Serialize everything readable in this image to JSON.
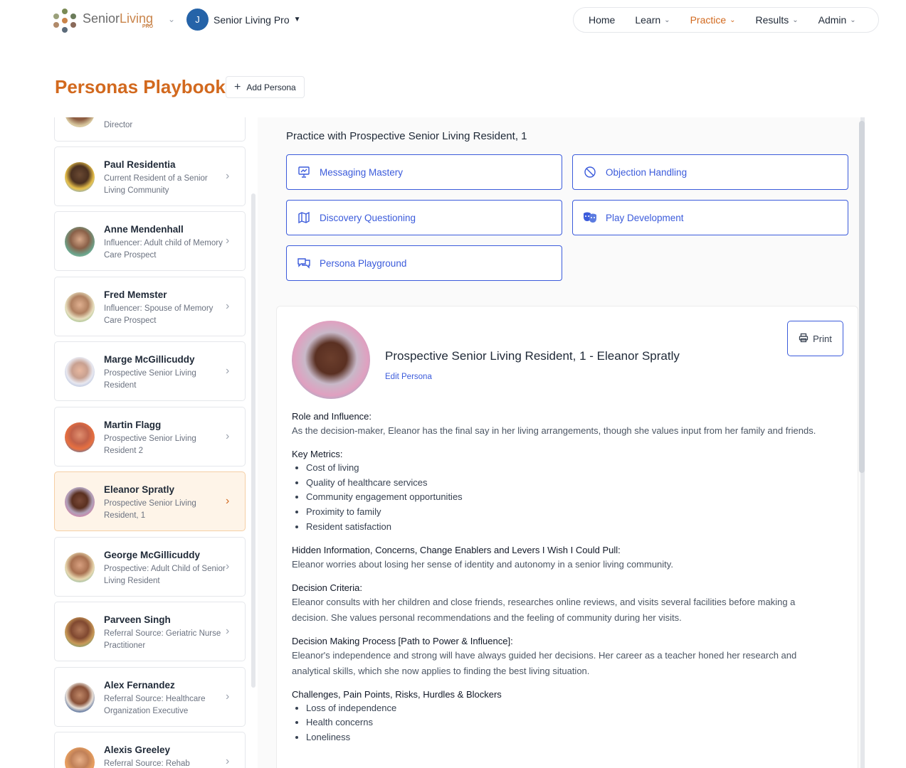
{
  "header": {
    "logo_text_a": "Senior",
    "logo_text_b": "Living",
    "logo_sub": "PRO",
    "org_initial": "J",
    "org_name": "Senior Living Pro",
    "nav": [
      {
        "label": "Home",
        "has_menu": false,
        "active": false
      },
      {
        "label": "Learn",
        "has_menu": true,
        "active": false
      },
      {
        "label": "Practice",
        "has_menu": true,
        "active": true
      },
      {
        "label": "Results",
        "has_menu": true,
        "active": false
      },
      {
        "label": "Admin",
        "has_menu": true,
        "active": false
      }
    ]
  },
  "page": {
    "title": "Personas Playbook",
    "add_button": "Add Persona"
  },
  "personas": [
    {
      "name": "",
      "role": "Director"
    },
    {
      "name": "Paul Residentia",
      "role": "Current Resident of a Senior Living Community"
    },
    {
      "name": "Anne Mendenhall",
      "role": "Influencer: Adult child of Memory Care Prospect"
    },
    {
      "name": "Fred Memster",
      "role": "Influencer: Spouse of Memory Care Prospect"
    },
    {
      "name": "Marge McGillicuddy",
      "role": "Prospective Senior Living Resident"
    },
    {
      "name": "Martin Flagg",
      "role": "Prospective Senior Living Resident 2"
    },
    {
      "name": "Eleanor Spratly",
      "role": "Prospective Senior Living Resident, 1",
      "active": true
    },
    {
      "name": "George McGillicuddy",
      "role": "Prospective: Adult Child of Senior Living Resident"
    },
    {
      "name": "Parveen Singh",
      "role": "Referral Source: Geriatric Nurse Practitioner"
    },
    {
      "name": "Alex Fernandez",
      "role": "Referral Source: Healthcare Organization Executive"
    },
    {
      "name": "Alexis Greeley",
      "role": "Referral Source: Rehab"
    }
  ],
  "practice": {
    "title": "Practice with Prospective Senior Living Resident, 1",
    "buttons": [
      {
        "label": "Messaging Mastery",
        "icon": "presentation-icon"
      },
      {
        "label": "Objection Handling",
        "icon": "ban-icon"
      },
      {
        "label": "Discovery Questioning",
        "icon": "map-icon"
      },
      {
        "label": "Play Development",
        "icon": "theater-masks-icon"
      },
      {
        "label": "Persona Playground",
        "icon": "chat-bubbles-icon"
      }
    ]
  },
  "detail": {
    "title": "Prospective Senior Living Resident, 1 - Eleanor Spratly",
    "edit_link": "Edit Persona",
    "print": "Print",
    "sections": [
      {
        "heading": "Role and Influence:",
        "text": "As the decision-maker, Eleanor has the final say in her living arrangements, though she values input from her family and friends."
      },
      {
        "heading": "Key Metrics:",
        "items": [
          "Cost of living",
          "Quality of healthcare services",
          "Community engagement opportunities",
          "Proximity to family",
          "Resident satisfaction"
        ]
      },
      {
        "heading": "Hidden Information, Concerns, Change Enablers and Levers I Wish I Could Pull:",
        "text": "Eleanor worries about losing her sense of identity and autonomy in a senior living community."
      },
      {
        "heading": "Decision Criteria:",
        "text": "Eleanor consults with her children and close friends, researches online reviews, and visits several facilities before making a decision. She values personal recommendations and the feeling of community during her visits."
      },
      {
        "heading": "Decision Making Process [Path to Power & Influence]:",
        "text": "Eleanor's independence and strong will have always guided her decisions. Her career as a teacher honed her research and analytical skills, which she now applies to finding the best living situation."
      },
      {
        "heading": "Challenges, Pain Points, Risks, Hurdles & Blockers",
        "items": [
          "Loss of independence",
          "Health concerns",
          "Loneliness"
        ]
      }
    ]
  },
  "colors": {
    "accent": "#d2691e",
    "primary": "#3b5bdb",
    "active_card_bg": "#fef4e8"
  }
}
